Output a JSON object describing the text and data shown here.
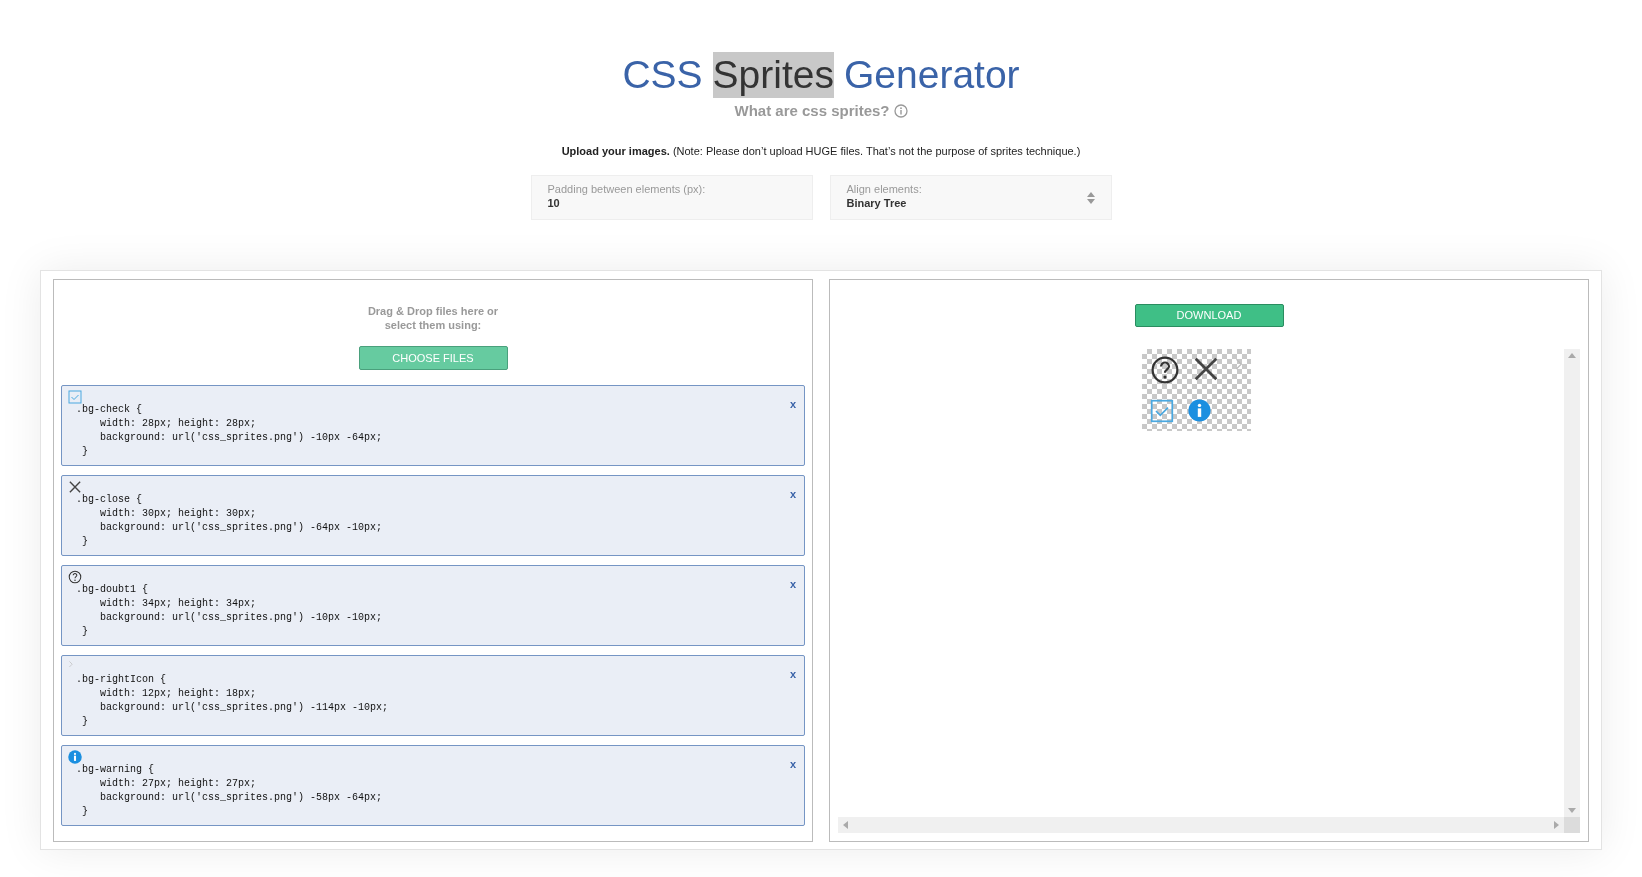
{
  "header": {
    "title_parts": [
      {
        "text": "CSS",
        "selected": false
      },
      {
        "text": "Sprites",
        "selected": true
      },
      {
        "text": "Generator",
        "selected": false
      }
    ],
    "subtitle": "What are css sprites?"
  },
  "upload_note": "**Upload your images.** (Note: Please don’t upload HUGE files. That’s not the purpose of sprites technique.)",
  "settings": {
    "padding": {
      "label": "Padding between elements (px):",
      "value": "10"
    },
    "align": {
      "label": "Align elements:",
      "value": "Binary Tree"
    }
  },
  "upload_panel": {
    "drop_hint": "Drag & Drop files here or\nselect them using:",
    "button": "CHOOSE FILES",
    "sprites": [
      {
        "kind": "check",
        "code": ".bg-check {\n    width: 28px; height: 28px;\n    background: url('css_sprites.png') -10px -64px;\n }",
        "remove": "x"
      },
      {
        "kind": "close",
        "code": ".bg-close {\n    width: 30px; height: 30px;\n    background: url('css_sprites.png') -64px -10px;\n }",
        "remove": "x"
      },
      {
        "kind": "doubt",
        "code": ".bg-doubt1 {\n    width: 34px; height: 34px;\n    background: url('css_sprites.png') -10px -10px;\n }",
        "remove": "x"
      },
      {
        "kind": "right",
        "code": ".bg-rightIcon {\n    width: 12px; height: 18px;\n    background: url('css_sprites.png') -114px -10px;\n }",
        "remove": "x"
      },
      {
        "kind": "info",
        "code": ".bg-warning {\n    width: 27px; height: 27px;\n    background: url('css_sprites.png') -58px -64px;\n }",
        "remove": "x"
      }
    ]
  },
  "result_panel": {
    "button": "DOWNLOAD"
  }
}
